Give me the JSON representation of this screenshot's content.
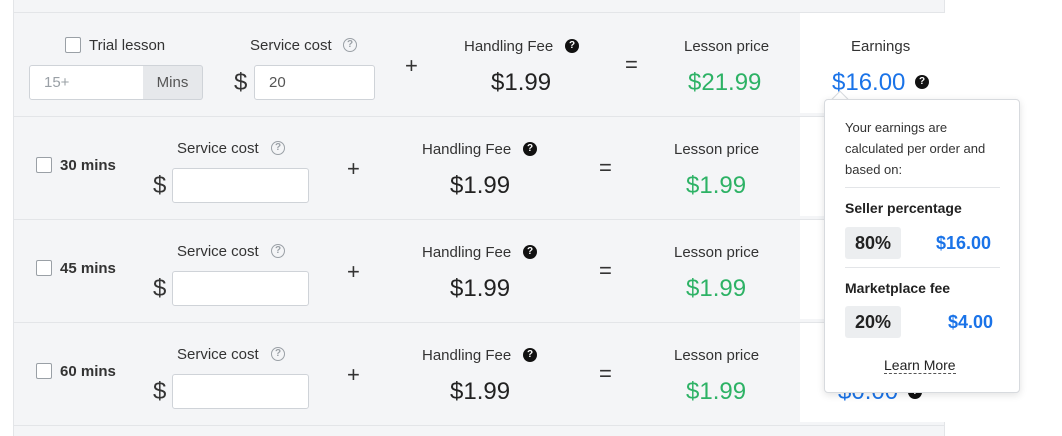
{
  "trial": {
    "checkbox_label": "Trial lesson",
    "duration_placeholder": "15+",
    "duration_suffix": "Mins",
    "service_cost_label": "Service cost",
    "currency": "$",
    "service_cost_value": "20",
    "plus": "+",
    "handling_fee_label": "Handling Fee",
    "handling_fee_value": "$1.99",
    "equals": "=",
    "lesson_price_label": "Lesson price",
    "lesson_price_value": "$21.99",
    "earnings_label": "Earnings",
    "earnings_value": "$16.00"
  },
  "rows": [
    {
      "checkbox_label": "30 mins",
      "service_cost_label": "Service cost",
      "currency": "$",
      "service_cost_value": "",
      "plus": "+",
      "handling_fee_label": "Handling Fee",
      "handling_fee_value": "$1.99",
      "equals": "=",
      "lesson_price_label": "Lesson price",
      "lesson_price_value": "$1.99"
    },
    {
      "checkbox_label": "45 mins",
      "service_cost_label": "Service cost",
      "currency": "$",
      "service_cost_value": "",
      "plus": "+",
      "handling_fee_label": "Handling Fee",
      "handling_fee_value": "$1.99",
      "equals": "=",
      "lesson_price_label": "Lesson price",
      "lesson_price_value": "$1.99"
    },
    {
      "checkbox_label": "60 mins",
      "service_cost_label": "Service cost",
      "currency": "$",
      "service_cost_value": "",
      "plus": "+",
      "handling_fee_label": "Handling Fee",
      "handling_fee_value": "$1.99",
      "equals": "=",
      "lesson_price_label": "Lesson price",
      "lesson_price_value": "$1.99",
      "earnings_value_partial": "$0.00"
    }
  ],
  "tooltip": {
    "intro": "Your earnings are calculated per order and based on:",
    "seller_heading": "Seller percentage",
    "seller_pct": "80%",
    "seller_amount": "$16.00",
    "marketplace_heading": "Marketplace fee",
    "marketplace_pct": "20%",
    "marketplace_amount": "$4.00",
    "learn_more": "Learn More"
  },
  "icons": {
    "help": "question-circle-outline",
    "info": "question-circle-filled"
  },
  "colors": {
    "lesson_price": "#2db265",
    "earnings": "#1a73e8",
    "panel_bg": "#f4f5f7"
  }
}
